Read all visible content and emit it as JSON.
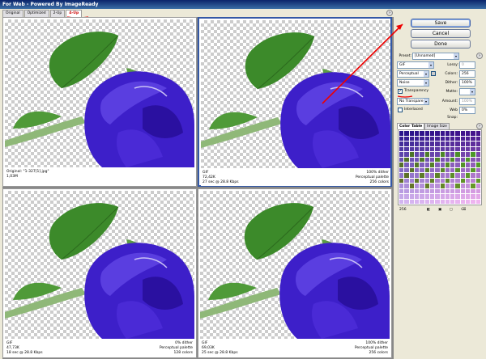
{
  "window": {
    "title": "For Web - Powered By ImageReady"
  },
  "tabs": [
    "Original",
    "Optimized",
    "2-Up",
    "4-Up"
  ],
  "panes": [
    {
      "left": [
        "Original: \"1-327[1].jpg\"",
        "1,03M"
      ],
      "right": [
        "",
        "",
        ""
      ]
    },
    {
      "left": [
        "GIF",
        "72,42K",
        "27 sec @ 28.8 Kbps"
      ],
      "right": [
        "100% dither",
        "Perceptual palette",
        "256 colors"
      ]
    },
    {
      "left": [
        "GIF",
        "47,73K",
        "18 sec @ 28.8 Kbps"
      ],
      "right": [
        "0% dither",
        "Perceptual palette",
        "128 colors"
      ]
    },
    {
      "left": [
        "GIF",
        "69,03K",
        "25 sec @ 28.8 Kbps"
      ],
      "right": [
        "100% dither",
        "Perceptual palette",
        "256 colors"
      ]
    }
  ],
  "buttons": {
    "save": "Save",
    "cancel": "Cancel",
    "done": "Done"
  },
  "settings": {
    "preset_label": "Preset:",
    "preset": "[Unnamed]",
    "format": "GIF",
    "lossy_label": "Lossy:",
    "lossy": "0",
    "palette": "Perceptual",
    "colors_label": "Colors:",
    "colors": "256",
    "dither_algo": "Noise",
    "dither_label": "Dither:",
    "dither": "100%",
    "transparency": "Transparency",
    "matte_label": "Matte:",
    "trans_dither": "No Transparen...",
    "amount_label": "Amount:",
    "amount": "100%",
    "interlaced": "Interlaced",
    "websnap_label": "Web Snap:",
    "websnap": "0%"
  },
  "color_table": {
    "tabs": [
      "Color Table",
      "Image Size"
    ],
    "count": "256"
  }
}
